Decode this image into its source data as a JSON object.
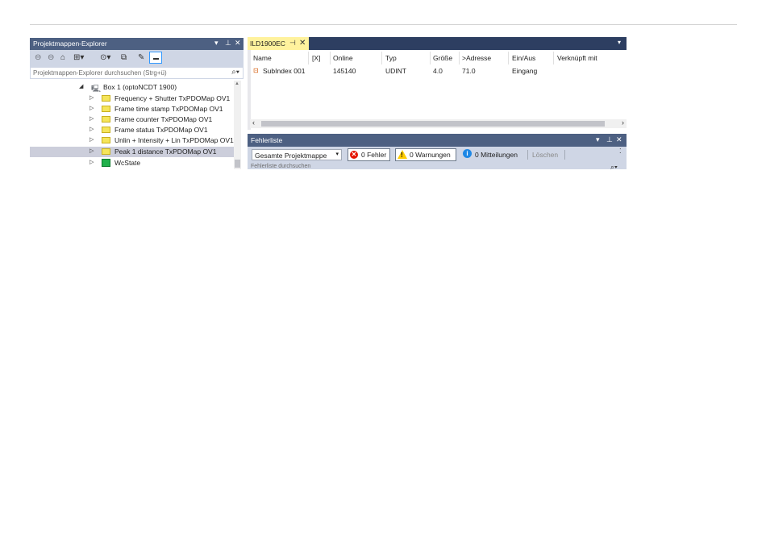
{
  "solution_explorer": {
    "title": "Projektmappen-Explorer",
    "title_controls": {
      "dropdown": "▾",
      "pin": "⊥",
      "close": "✕"
    },
    "toolbar_icons": [
      "back-icon",
      "forward-icon",
      "home-icon",
      "switch-views-icon",
      "pending-changes-icon",
      "collapse-all-icon",
      "properties-icon",
      "preview-icon"
    ],
    "search_placeholder": "Projektmappen-Explorer durchsuchen (Strg+ü)",
    "tree": [
      {
        "label": "Box 1 (optoNCDT 1900)",
        "expander": "◢",
        "icon": "box-icon"
      },
      {
        "label": "Frequency + Shutter TxPDOMap OV1",
        "expander": "▷",
        "icon": "folder-icon"
      },
      {
        "label": "Frame time stamp TxPDOMap OV1",
        "expander": "▷",
        "icon": "folder-icon"
      },
      {
        "label": "Frame counter TxPDOMap OV1",
        "expander": "▷",
        "icon": "folder-icon"
      },
      {
        "label": "Frame status TxPDOMap OV1",
        "expander": "▷",
        "icon": "folder-icon"
      },
      {
        "label": "Unlin + Intensity + Lin TxPDOMap OV1",
        "expander": "▷",
        "icon": "folder-icon"
      },
      {
        "label": "Peak 1 distance TxPDOMap OV1",
        "expander": "▷",
        "icon": "folder-icon",
        "selected": true
      },
      {
        "label": "WcState",
        "expander": "▷",
        "icon": "wcstate-icon"
      }
    ]
  },
  "document": {
    "tab_label": "ILD1900EC",
    "tab_pin": "⊣",
    "tab_close": "✕",
    "columns": [
      "Name",
      "[X]",
      "Online",
      "Typ",
      "Größe",
      ">Adresse",
      "Ein/Aus",
      "Verknüpft mit"
    ],
    "rows": [
      {
        "name": "SubIndex 001",
        "x": "",
        "online": "145140",
        "typ": "UDINT",
        "groesse": "4.0",
        "adresse": "71.0",
        "einaus": "Eingang",
        "verknuepft": ""
      }
    ]
  },
  "error_list": {
    "title": "Fehlerliste",
    "title_controls": {
      "dropdown": "▾",
      "pin": "⊥",
      "close": "✕"
    },
    "filter_value": "Gesamte Projektmappe",
    "errors_label": "0 Fehler",
    "warnings_label": "0 Warnungen",
    "messages_label": "0 Mitteilungen",
    "clear_label": "Löschen",
    "search_placeholder": "Fehlerliste durchsuchen"
  },
  "colors": {
    "tool_window_title": "#4d6082",
    "document_header": "#2d3e61",
    "active_tab": "#fff29d",
    "toolbar_bg": "#cfd6e5",
    "selection": "#cccedb"
  }
}
